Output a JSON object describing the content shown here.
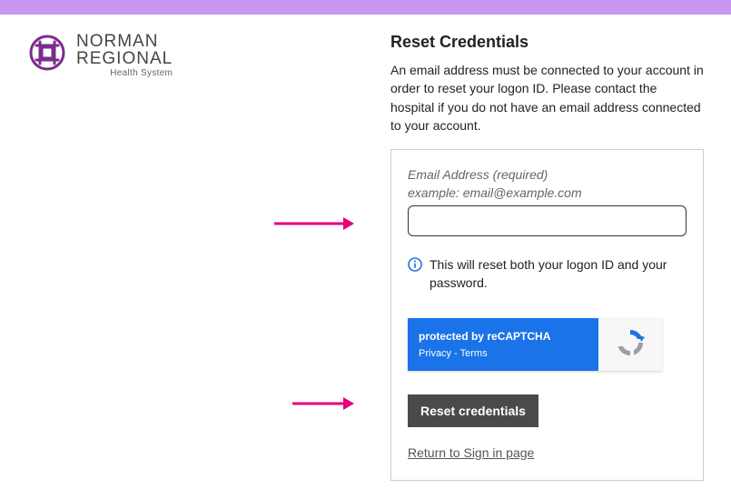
{
  "brand": {
    "line1": "NORMAN",
    "line2": "REGIONAL",
    "subtitle": "Health System"
  },
  "heading": "Reset Credentials",
  "description": "An email address must be connected to your account in order to reset your logon ID. Please contact the hospital if you do not have an email address connected to your account.",
  "form": {
    "email_label": "Email Address (required)",
    "email_hint": "example: email@example.com",
    "email_value": "",
    "info_text": "This will reset both your logon ID and your password.",
    "recaptcha_protected": "protected by reCAPTCHA",
    "recaptcha_privacy": "Privacy",
    "recaptcha_separator": " - ",
    "recaptcha_terms": "Terms",
    "submit_label": "Reset credentials",
    "return_link": "Return to Sign in page"
  },
  "colors": {
    "accent_bar": "#c895f0",
    "captcha_blue": "#1a73e8",
    "button_bg": "#4a4a4a",
    "brand_icon": "#7b2c8e"
  }
}
